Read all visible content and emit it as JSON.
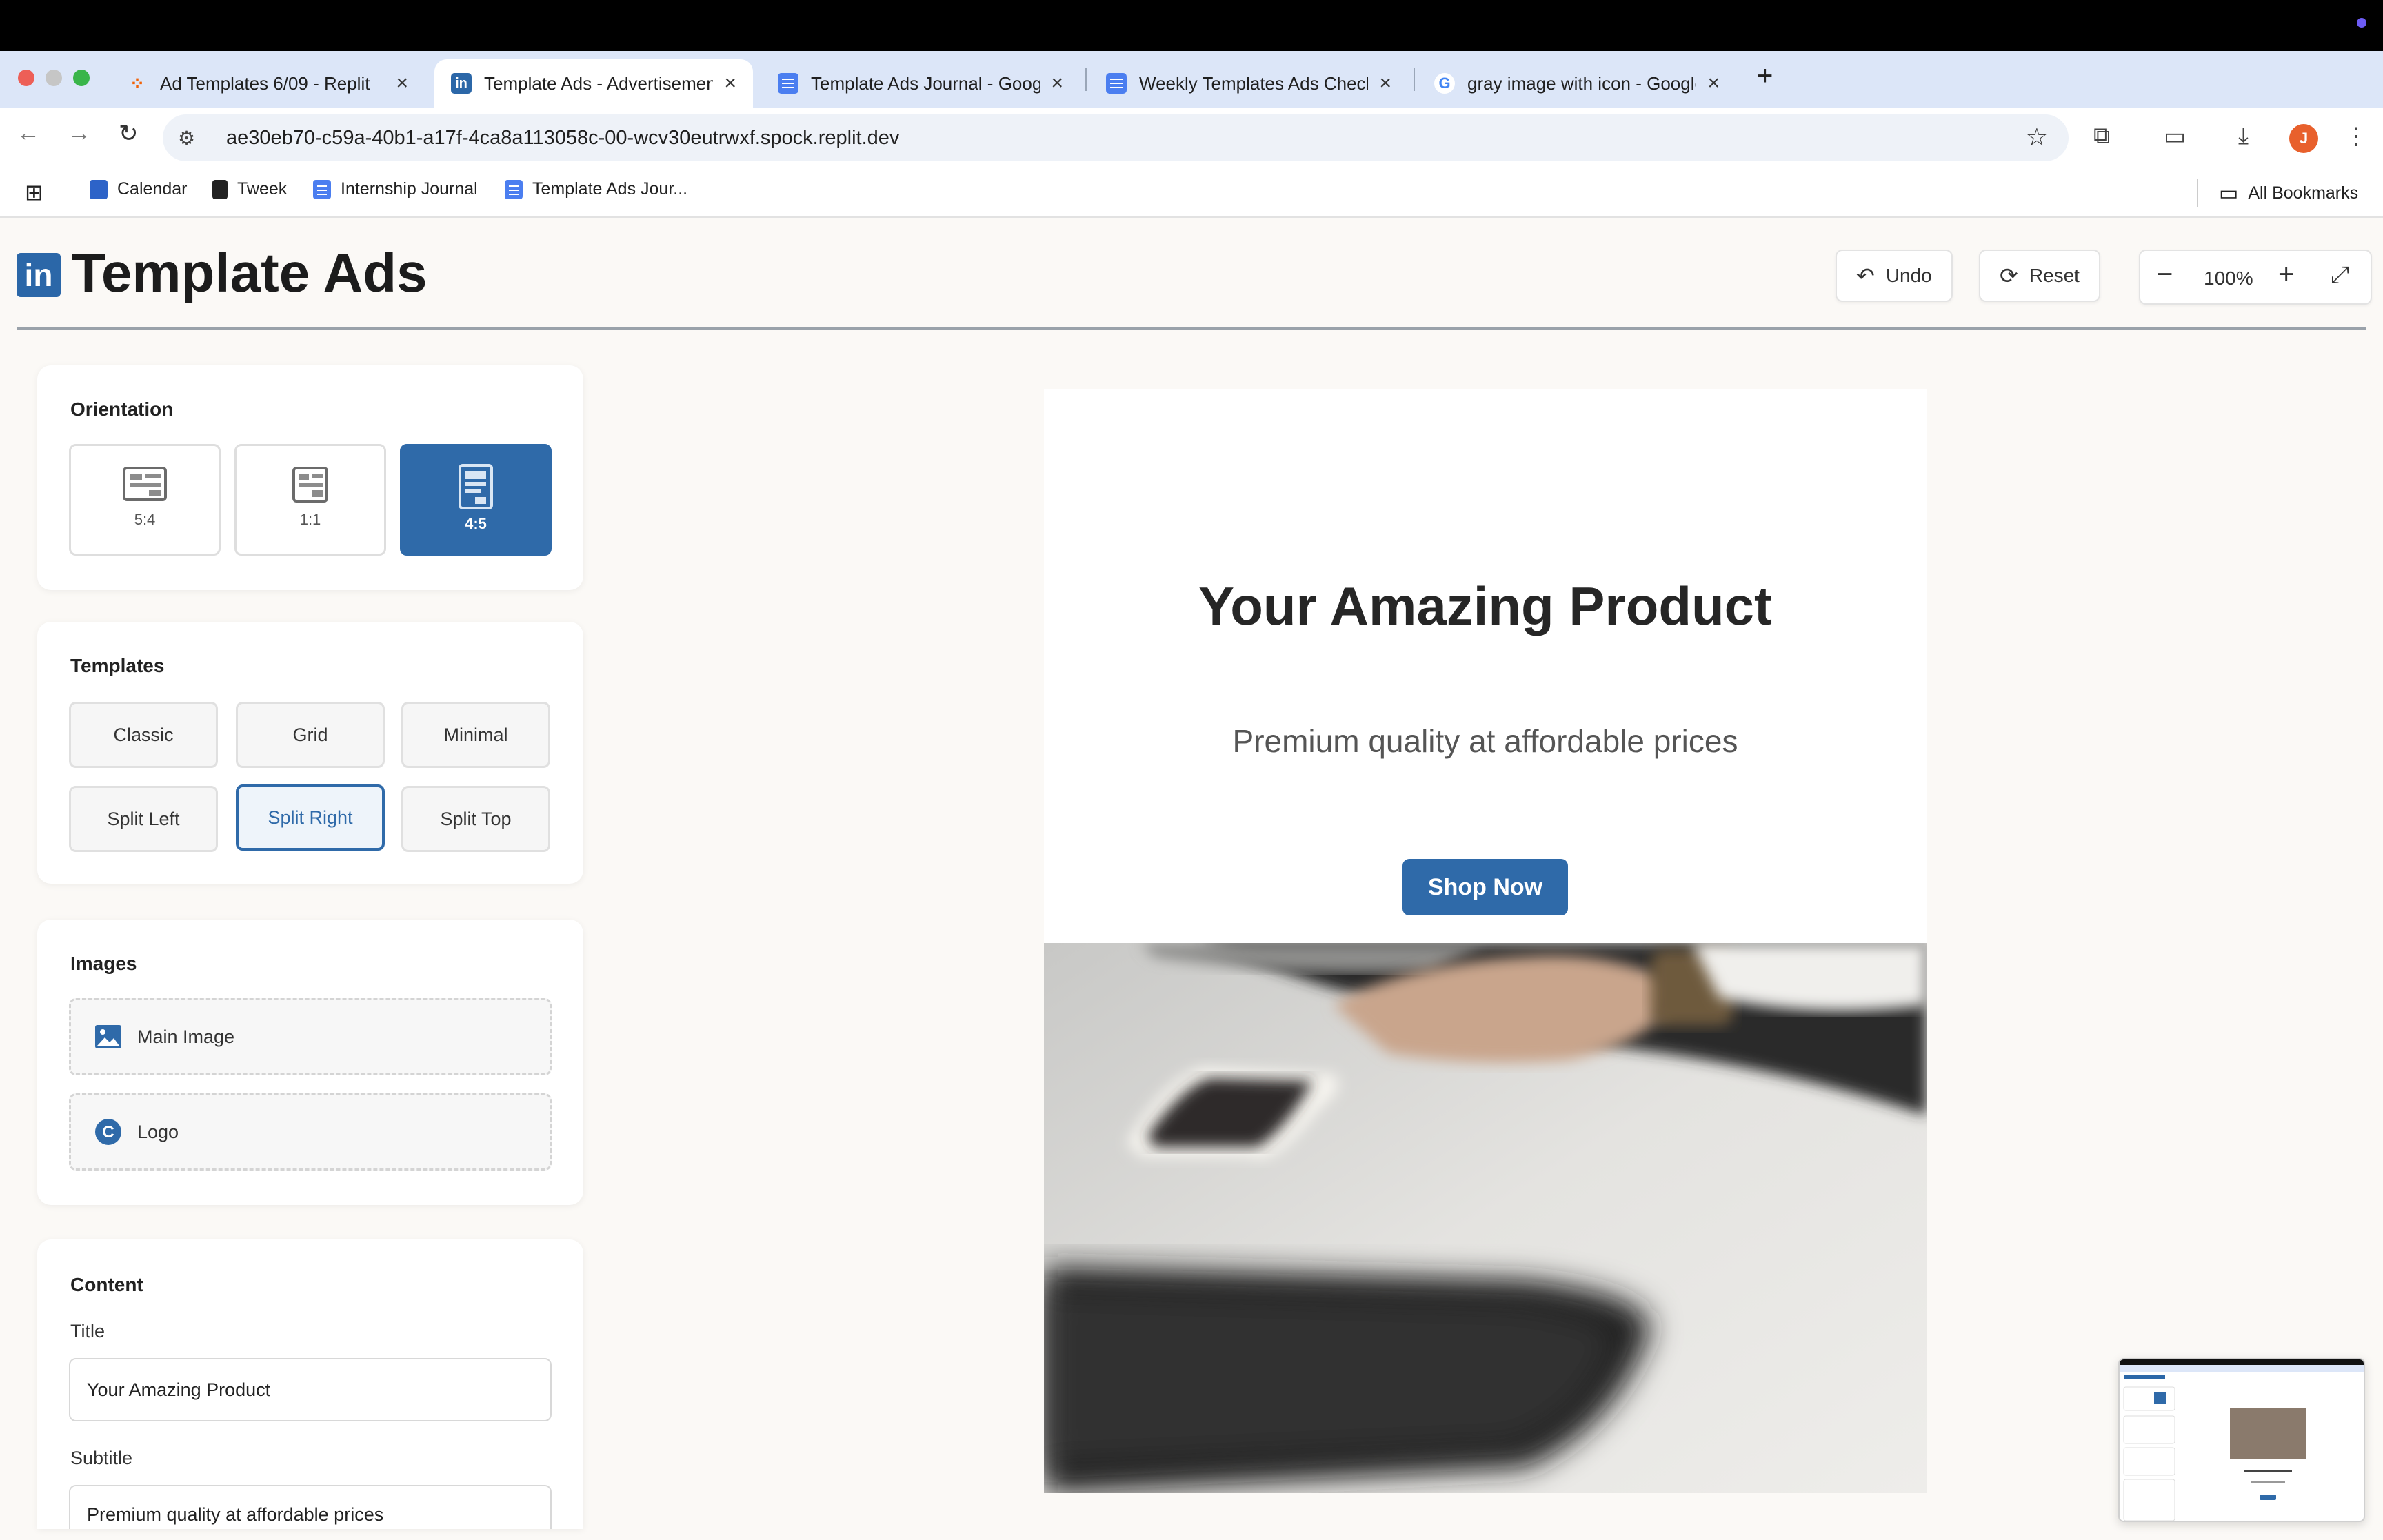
{
  "browser": {
    "tabs": [
      {
        "title": "Ad Templates 6/09 - Replit"
      },
      {
        "title": "Template Ads - Advertisement"
      },
      {
        "title": "Template Ads Journal - Google"
      },
      {
        "title": "Weekly Templates Ads Check"
      },
      {
        "title": "gray image with icon - Google"
      }
    ],
    "url": "ae30eb70-c59a-40b1-a17f-4ca8a113058c-00-wcv30eutrwxf.spock.replit.dev",
    "profile_initial": "J",
    "bookmarks": [
      "Calendar",
      "Tweek",
      "Internship Journal",
      "Template Ads Jour..."
    ],
    "all_bookmarks": "All Bookmarks"
  },
  "app": {
    "logo": "in",
    "title": "Template Ads",
    "undo_label": "Undo",
    "reset_label": "Reset",
    "zoom_value": "100%",
    "brand_color": "#2f6aa9"
  },
  "sidebar": {
    "orientation": {
      "title": "Orientation",
      "options": [
        {
          "label": "5:4",
          "selected": false
        },
        {
          "label": "1:1",
          "selected": false
        },
        {
          "label": "4:5",
          "selected": true
        }
      ]
    },
    "templates": {
      "title": "Templates",
      "options": [
        "Classic",
        "Grid",
        "Minimal",
        "Split Left",
        "Split Right",
        "Split Top"
      ],
      "selected": "Split Right"
    },
    "images": {
      "title": "Images",
      "main_image": "Main Image",
      "logo": "Logo"
    },
    "content": {
      "title": "Content",
      "title_label": "Title",
      "title_value": "Your Amazing Product",
      "subtitle_label": "Subtitle",
      "subtitle_value": "Premium quality at affordable prices"
    }
  },
  "preview": {
    "title": "Your Amazing Product",
    "subtitle": "Premium quality at affordable prices",
    "cta": "Shop Now"
  }
}
